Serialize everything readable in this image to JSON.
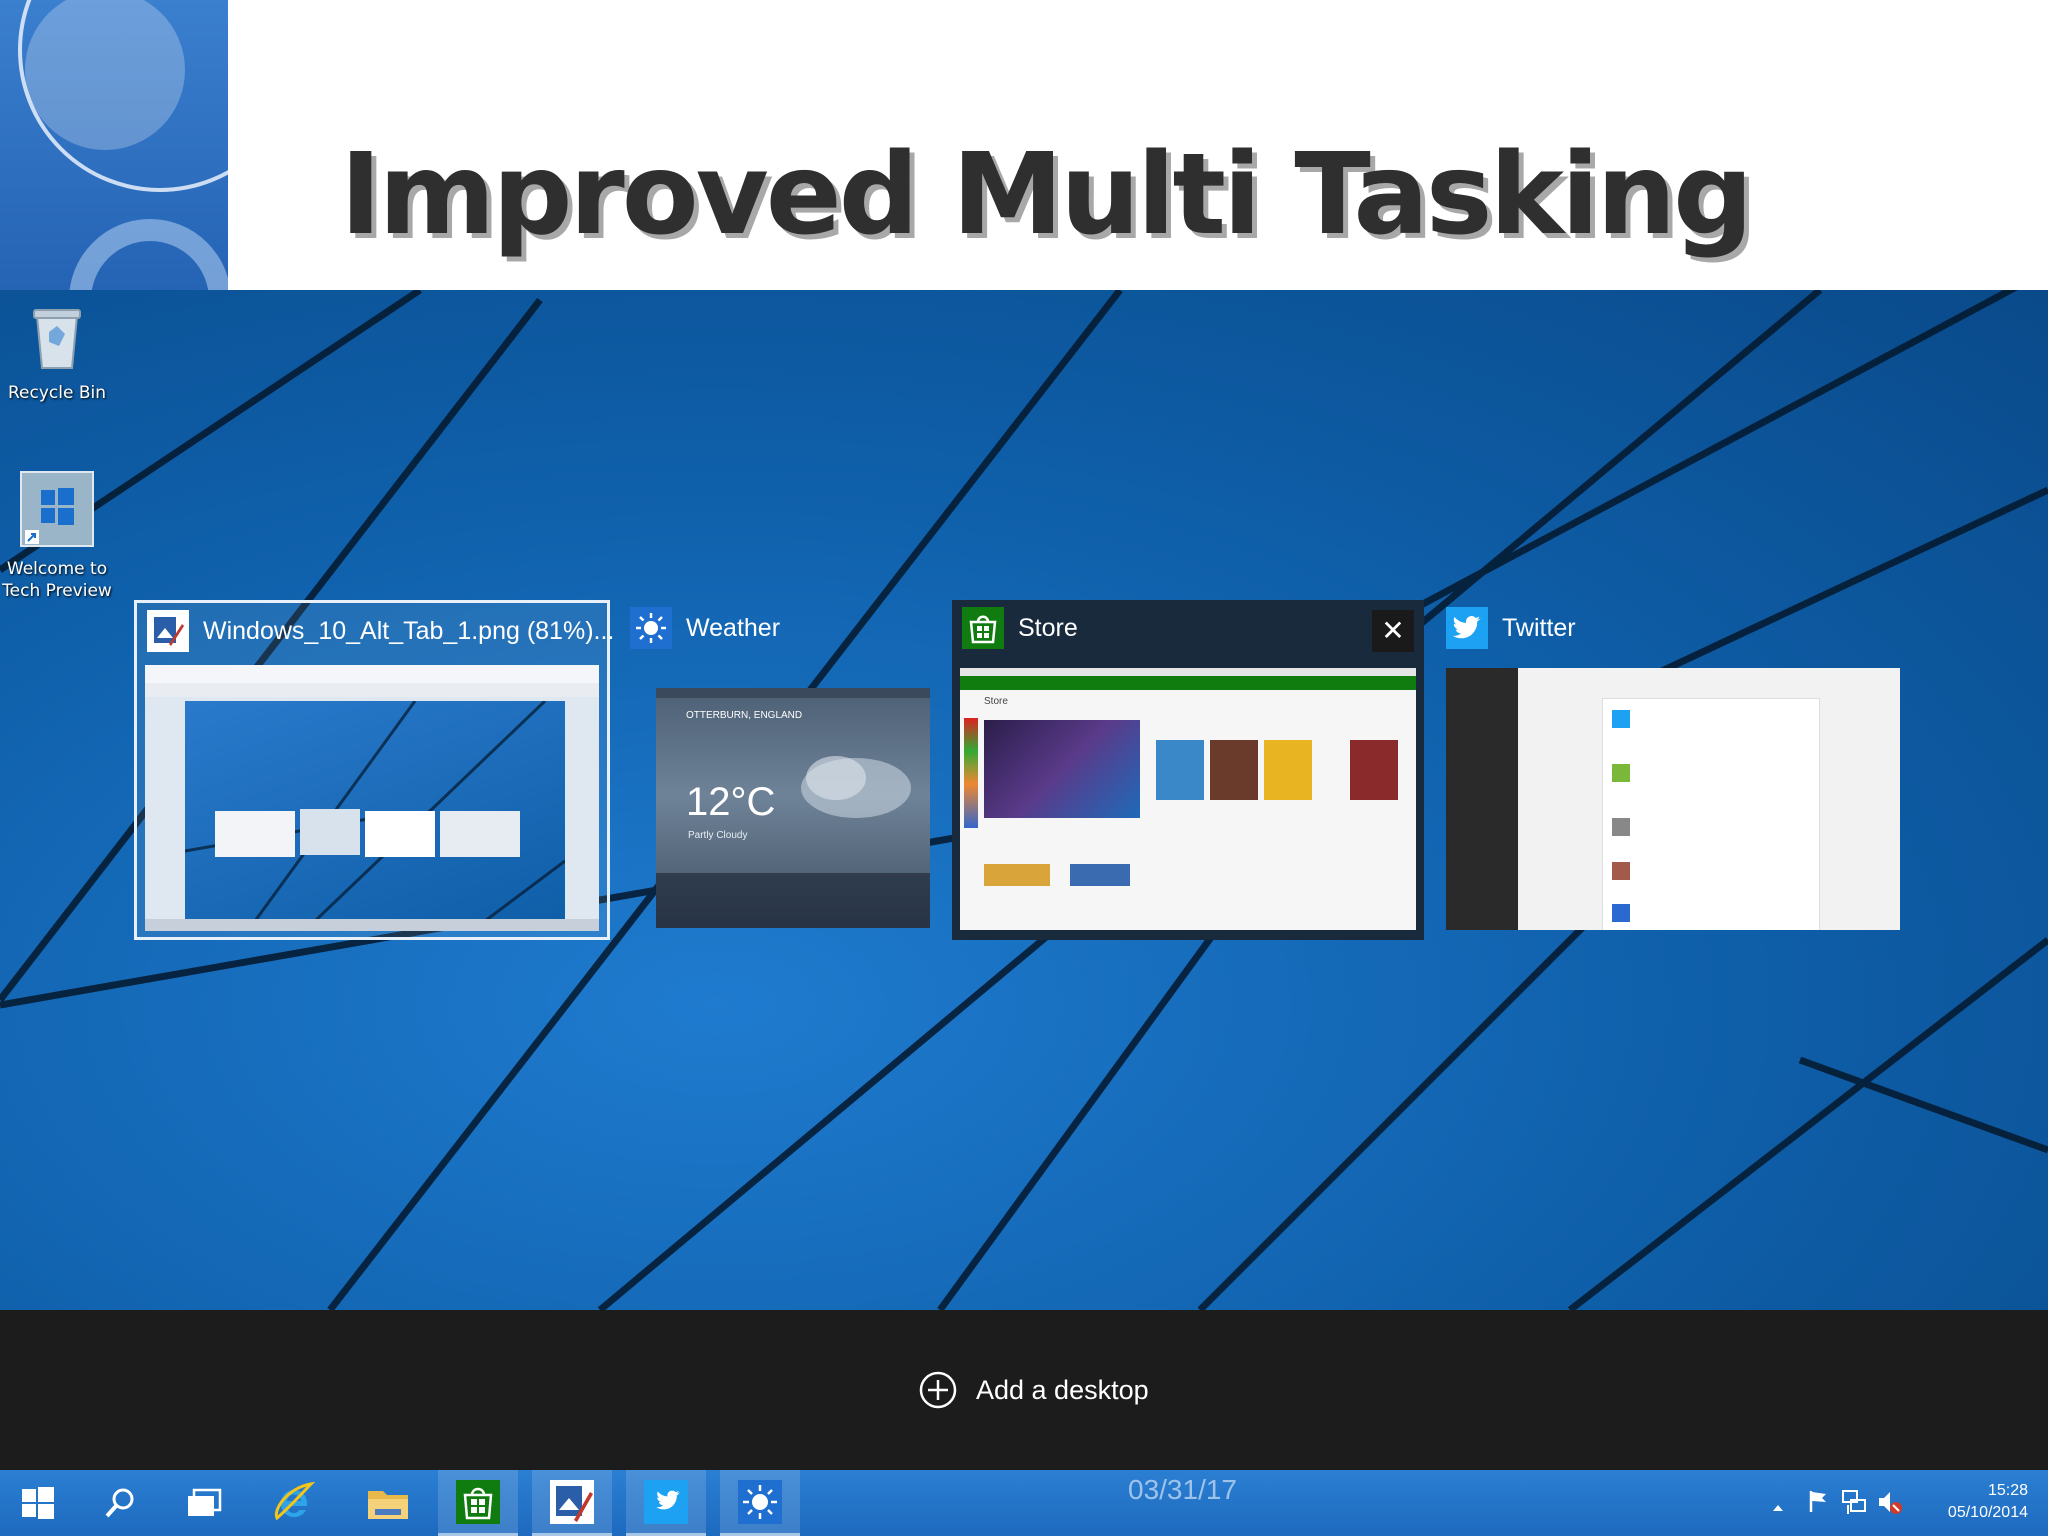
{
  "slide": {
    "title": "Improved Multi Tasking",
    "date": "03/31/17"
  },
  "desktop_icons": [
    {
      "label": "Recycle Bin",
      "icon": "recycle-bin-icon"
    },
    {
      "label": "Welcome to Tech Preview",
      "label_lines": [
        "Welcome to",
        "Tech Preview"
      ],
      "icon": "windows-logo-icon"
    }
  ],
  "task_view": {
    "windows": [
      {
        "title": "Windows_10_Alt_Tab_1.png (81%)...",
        "icon": "photo-viewer-icon",
        "selected": true
      },
      {
        "title": "Weather",
        "icon": "sun-icon",
        "location": "OTTERBURN, ENGLAND",
        "temperature": "12°C",
        "condition": "Partly Cloudy"
      },
      {
        "title": "Store",
        "icon": "store-bag-icon",
        "hovered": true,
        "page_heading": "Store"
      },
      {
        "title": "Twitter",
        "icon": "twitter-bird-icon"
      }
    ],
    "close_label": "✕"
  },
  "virtual_desktops": {
    "add_label": "Add a desktop"
  },
  "taskbar": {
    "buttons": [
      {
        "name": "start",
        "icon": "windows-logo-icon"
      },
      {
        "name": "search",
        "icon": "search-icon"
      },
      {
        "name": "task-view",
        "icon": "task-view-icon"
      },
      {
        "name": "internet-explorer",
        "icon": "ie-icon"
      },
      {
        "name": "file-explorer",
        "icon": "folder-icon"
      },
      {
        "name": "store",
        "icon": "store-bag-icon",
        "running": true
      },
      {
        "name": "photo-viewer",
        "icon": "photo-viewer-icon",
        "running": true
      },
      {
        "name": "twitter",
        "icon": "twitter-bird-icon",
        "running": true
      },
      {
        "name": "weather",
        "icon": "sun-icon",
        "running": true
      }
    ],
    "clock": {
      "time": "15:28",
      "date": "05/10/2014"
    }
  },
  "colors": {
    "desktop_blue": "#0e5ea8",
    "store_green": "#107c10",
    "twitter_blue": "#1da1f2",
    "weather_blue": "#1e6fd0",
    "vd_bar": "#1c1c1c"
  }
}
